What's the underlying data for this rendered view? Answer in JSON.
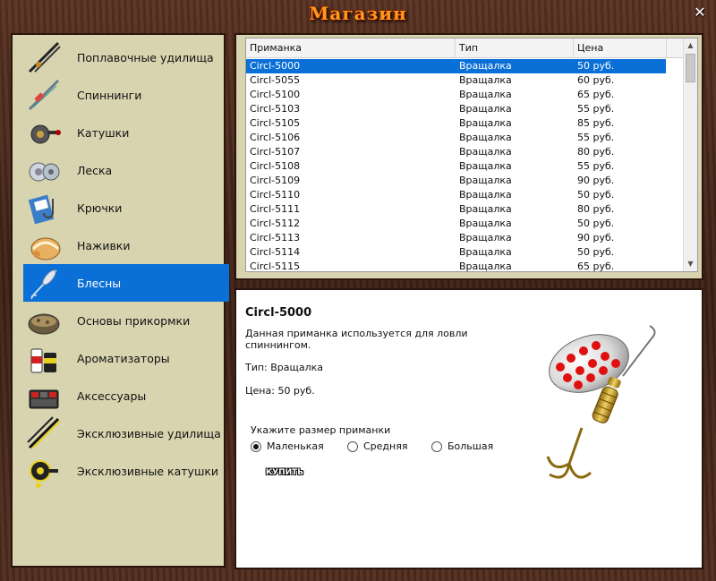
{
  "window": {
    "title": "Магазин",
    "close_icon": "close-icon"
  },
  "sidebar": {
    "items": [
      {
        "label": "Поплавочные удилища",
        "icon": "float-rod-icon"
      },
      {
        "label": "Спиннинги",
        "icon": "spinning-rod-icon"
      },
      {
        "label": "Катушки",
        "icon": "reel-icon"
      },
      {
        "label": "Леска",
        "icon": "fishing-line-icon"
      },
      {
        "label": "Крючки",
        "icon": "hooks-icon"
      },
      {
        "label": "Наживки",
        "icon": "bait-icon"
      },
      {
        "label": "Блесны",
        "icon": "lure-icon",
        "active": true
      },
      {
        "label": "Основы прикормки",
        "icon": "groundbait-icon"
      },
      {
        "label": "Ароматизаторы",
        "icon": "flavoring-icon"
      },
      {
        "label": "Аксессуары",
        "icon": "tackle-box-icon"
      },
      {
        "label": "Эксклюзивные удилища",
        "icon": "exclusive-rod-icon"
      },
      {
        "label": "Эксклюзивные катушки",
        "icon": "exclusive-reel-icon"
      }
    ]
  },
  "table": {
    "columns": [
      "Приманка",
      "Тип",
      "Цена"
    ],
    "rows": [
      [
        "Circl-5000",
        "Вращалка",
        "50 руб."
      ],
      [
        "Circl-5055",
        "Вращалка",
        "60 руб."
      ],
      [
        "Circl-5100",
        "Вращалка",
        "65 руб."
      ],
      [
        "Circl-5103",
        "Вращалка",
        "55 руб."
      ],
      [
        "Circl-5105",
        "Вращалка",
        "85 руб."
      ],
      [
        "Circl-5106",
        "Вращалка",
        "55 руб."
      ],
      [
        "Circl-5107",
        "Вращалка",
        "80 руб."
      ],
      [
        "Circl-5108",
        "Вращалка",
        "55 руб."
      ],
      [
        "Circl-5109",
        "Вращалка",
        "90 руб."
      ],
      [
        "Circl-5110",
        "Вращалка",
        "50 руб."
      ],
      [
        "Circl-5111",
        "Вращалка",
        "80 руб."
      ],
      [
        "Circl-5112",
        "Вращалка",
        "50 руб."
      ],
      [
        "Circl-5113",
        "Вращалка",
        "90 руб."
      ],
      [
        "Circl-5114",
        "Вращалка",
        "50 руб."
      ],
      [
        "Circl-5115",
        "Вращалка",
        "65 руб."
      ]
    ],
    "selected_index": 0
  },
  "detail": {
    "name": "Circl-5000",
    "description": "Данная приманка используется для ловли спиннингом.",
    "type": "Тип: Вращалка",
    "price": "Цена: 50 руб.",
    "size_label": "Укажите размер приманки",
    "sizes": [
      "Маленькая",
      "Средняя",
      "Большая"
    ],
    "selected_size": "Маленькая",
    "buy_label": "КУПИТЬ"
  },
  "colors": {
    "accent": "#0a6fd6",
    "panel": "#d8d4b0",
    "title": "#ff9a1a",
    "wood": "#4a2a1c"
  }
}
